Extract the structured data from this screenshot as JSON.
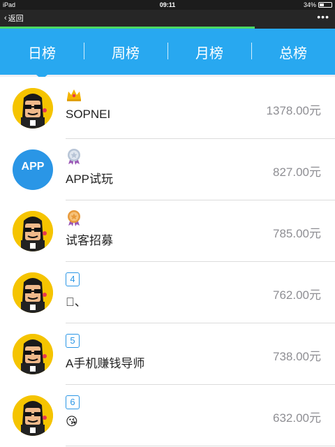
{
  "status": {
    "device": "iPad",
    "time": "09:11",
    "battery": "34%",
    "battery_level": 0.34
  },
  "nav": {
    "back_label": "返回",
    "more_label": "•••"
  },
  "page_progress": 0.76,
  "tabs": [
    {
      "label": "日榜",
      "active": true
    },
    {
      "label": "周榜",
      "active": false
    },
    {
      "label": "月榜",
      "active": false
    },
    {
      "label": "总榜",
      "active": false
    }
  ],
  "rows": [
    {
      "rank": "1",
      "badge": "crown-gold",
      "avatar": "cartoon",
      "name": "SOPNEI",
      "amount": "1378.00元"
    },
    {
      "rank": "2",
      "badge": "medal-silver",
      "avatar": "app-logo",
      "avatar_text": "APP",
      "name": "APP试玩",
      "amount": "827.00元"
    },
    {
      "rank": "3",
      "badge": "medal-bronze",
      "avatar": "cartoon",
      "name": "试客招募",
      "amount": "785.00元"
    },
    {
      "rank": "4",
      "badge": "number",
      "avatar": "cartoon",
      "name": "、",
      "amount": "762.00元"
    },
    {
      "rank": "5",
      "badge": "number",
      "avatar": "cartoon",
      "name": "A手机赚钱导师",
      "amount": "738.00元"
    },
    {
      "rank": "6",
      "badge": "number",
      "avatar": "cartoon",
      "name": "😘",
      "amount": "632.00元"
    }
  ]
}
